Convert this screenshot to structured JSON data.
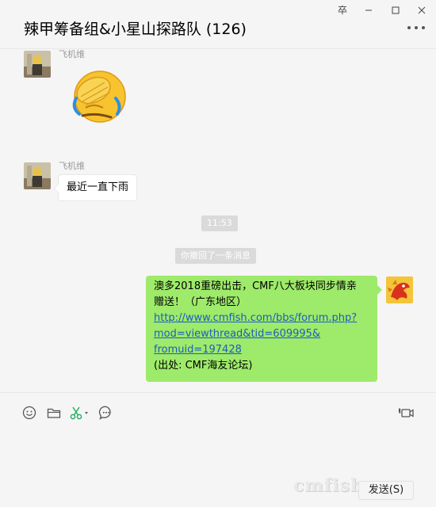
{
  "window": {
    "pin_label": "卒"
  },
  "header": {
    "title": "辣甲筹备组&小星山探路队 (126)"
  },
  "messages": [
    {
      "sender": "飞机维",
      "type": "sticker",
      "sticker": "facepalm-emoji"
    },
    {
      "sender": "飞机维",
      "type": "text",
      "text": "最近一直下雨"
    }
  ],
  "timestamp": "11:53",
  "system_notice": "你撤回了一条消息",
  "outgoing": {
    "line1": "澳多2018重磅出击，CMF八大板块同步情亲",
    "line2": "赠送！（广东地区）",
    "link_line1": "http://www.cmfish.com/bbs/forum.php?",
    "link_line2": "mod=viewthread&tid=609995&",
    "link_line3": "fromuid=197428",
    "source": "(出处: CMF海友论坛)"
  },
  "composer": {
    "tools": [
      "emoji-icon",
      "folder-icon",
      "scissors-icon",
      "chat-history-icon",
      "video-call-icon"
    ],
    "send_label": "发送(S)",
    "watermark": "cmfish"
  },
  "colors": {
    "outgoing_bubble": "#9eea6a",
    "incoming_bubble": "#ffffff",
    "link": "#1a5ebf",
    "scissors": "#2aae67"
  }
}
